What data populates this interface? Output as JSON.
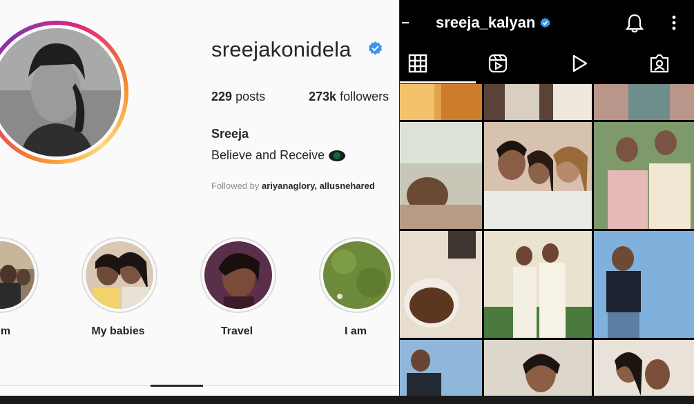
{
  "left": {
    "username": "sreejakonidela",
    "posts_count": "229",
    "posts_label": "posts",
    "followers_count": "273k",
    "followers_label": "followers",
    "name": "Sreeja",
    "bio": "Believe and Receive",
    "followed_prefix": "Followed by",
    "followed_names": "ariyanaglory, allusnehared",
    "highlights": [
      {
        "label": "m"
      },
      {
        "label": "My babies"
      },
      {
        "label": "Travel"
      },
      {
        "label": "I am"
      }
    ],
    "colors": {
      "verified": "#3897f0",
      "text": "#262626",
      "muted": "#8e8e8e"
    }
  },
  "right": {
    "username": "sreeja_kalyan",
    "tabs": [
      "grid-icon",
      "reels-icon",
      "play-icon",
      "tagged-icon"
    ],
    "header_icons": [
      "back-icon",
      "bell-icon",
      "more-icon"
    ]
  }
}
